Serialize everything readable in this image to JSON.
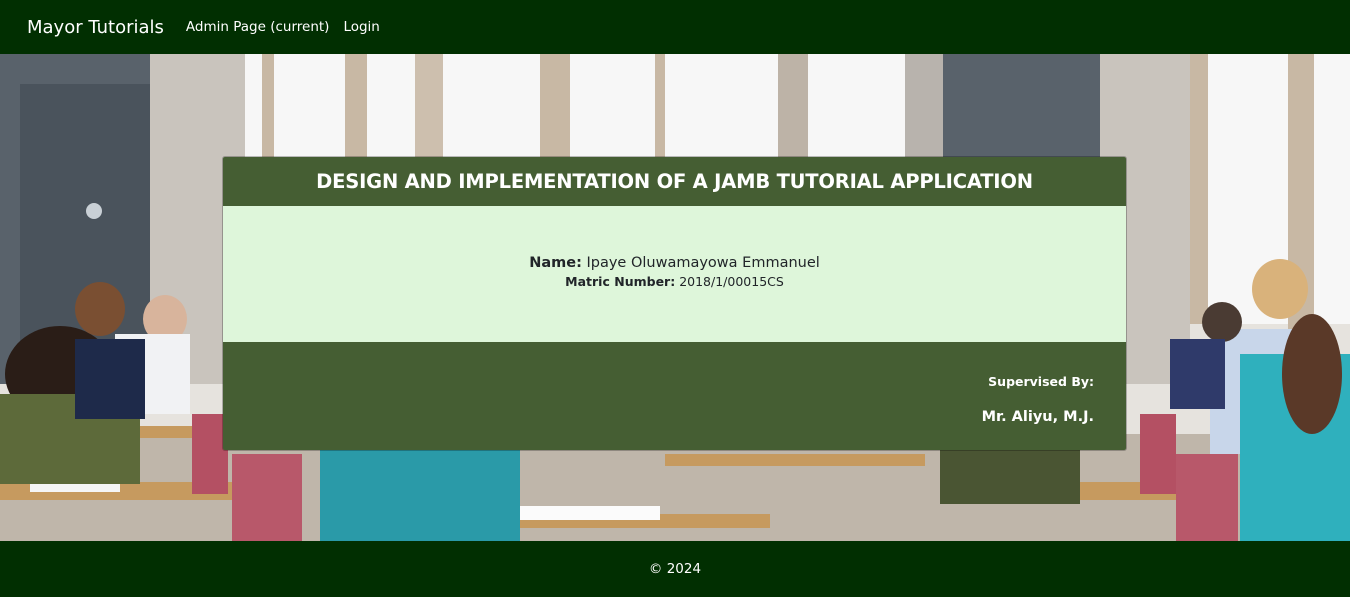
{
  "navbar": {
    "brand": "Mayor Tutorials",
    "links": [
      {
        "label": "Admin Page (current)"
      },
      {
        "label": "Login"
      }
    ]
  },
  "card": {
    "title": "DESIGN AND IMPLEMENTATION OF A JAMB TUTORIAL APPLICATION",
    "name_label": "Name:",
    "name_value": "Ipaye Oluwamayowa Emmanuel",
    "matric_label": "Matric Number:",
    "matric_value": "2018/1/00015CS",
    "supervised_label": "Supervised By:",
    "supervisor": "Mr. Aliyu, M.J."
  },
  "footer": {
    "copyright": "© 2024"
  },
  "colors": {
    "nav_bg": "#012f01",
    "card_header_bg": "#455e33",
    "card_body_bg": "#def6da"
  }
}
